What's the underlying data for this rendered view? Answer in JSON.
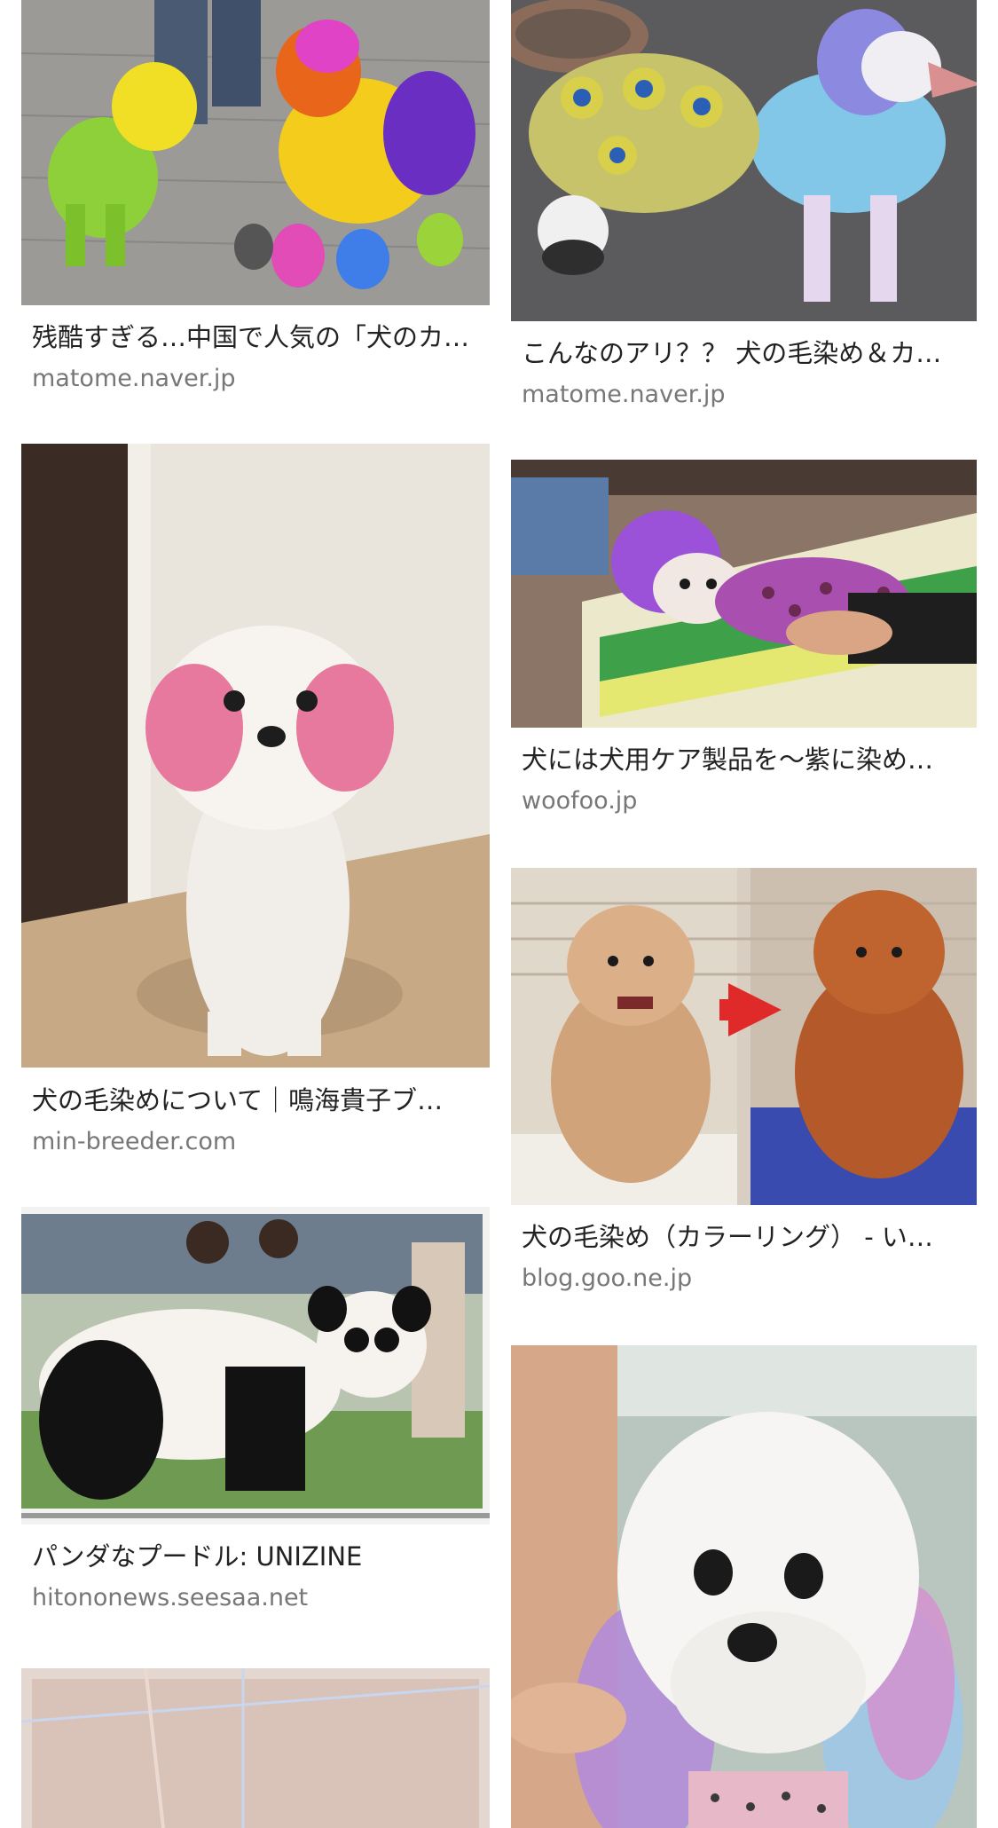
{
  "results": {
    "left": [
      {
        "title": "残酷すぎる…中国で人気の「犬のカ…",
        "source": "matome.naver.jp",
        "image": "rainbow-dyed-dogs-photo"
      },
      {
        "title": "犬の毛染めについて｜鳴海貴子ブ…",
        "source": "min-breeder.com",
        "image": "pink-ear-maltese-photo"
      },
      {
        "title": "パンダなプードル: UNIZINE",
        "source": "hitononews.seesaa.net",
        "image": "panda-poodle-photo"
      },
      {
        "title": "",
        "source": "",
        "image": "blurred-photo"
      }
    ],
    "right": [
      {
        "title": "こんなのアリ？？ 犬の毛染め＆カ…",
        "source": "matome.naver.jp",
        "image": "peacock-poodle-photo"
      },
      {
        "title": "犬には犬用ケア製品を〜紫に染め…",
        "source": "woofoo.jp",
        "image": "purple-dog-photo"
      },
      {
        "title": "犬の毛染め（カラーリング） - い…",
        "source": "blog.goo.ne.jp",
        "image": "before-after-poodle-photo"
      },
      {
        "title": "",
        "source": "",
        "image": "pastel-ear-poodle-photo"
      }
    ]
  }
}
